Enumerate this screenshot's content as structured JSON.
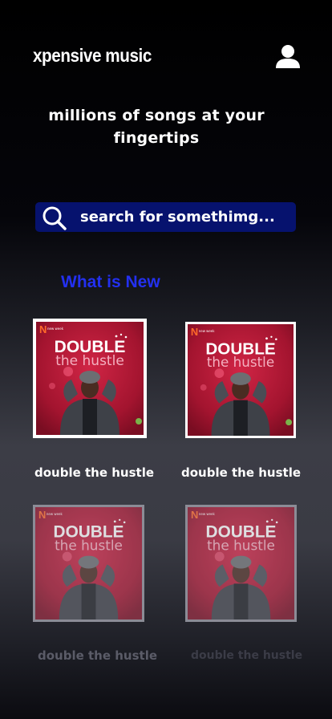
{
  "header": {
    "brand": "xpensive music",
    "user_icon": "user-icon"
  },
  "hero": {
    "tagline": "millions of songs at your fingertips"
  },
  "search": {
    "placeholder": "search for somethimg...",
    "icon": "search-icon"
  },
  "section": {
    "title": "What is New"
  },
  "cover_art": {
    "badge": "new week",
    "title_line1": "DOUBLE",
    "title_line2": "the hustle"
  },
  "albums": [
    {
      "title": "double the hustle"
    },
    {
      "title": "double the hustle"
    },
    {
      "title": "double the hustle"
    },
    {
      "title": "double the hustle"
    }
  ],
  "colors": {
    "search_bg": "#06126e",
    "section_title": "#2330f0",
    "cover_red": "#b0193a"
  }
}
